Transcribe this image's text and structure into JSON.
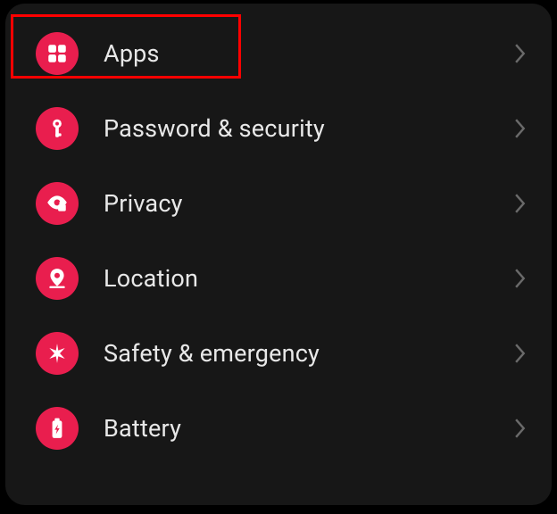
{
  "settings": {
    "items": [
      {
        "id": "apps",
        "label": "Apps",
        "highlighted": true
      },
      {
        "id": "password-security",
        "label": "Password & security",
        "highlighted": false
      },
      {
        "id": "privacy",
        "label": "Privacy",
        "highlighted": false
      },
      {
        "id": "location",
        "label": "Location",
        "highlighted": false
      },
      {
        "id": "safety-emergency",
        "label": "Safety & emergency",
        "highlighted": false
      },
      {
        "id": "battery",
        "label": "Battery",
        "highlighted": false
      }
    ]
  },
  "colors": {
    "accent": "#e91e4e",
    "background": "#171717",
    "text": "#e8e8e8",
    "chevron": "#6a6a6a",
    "highlight": "#ff0000"
  }
}
